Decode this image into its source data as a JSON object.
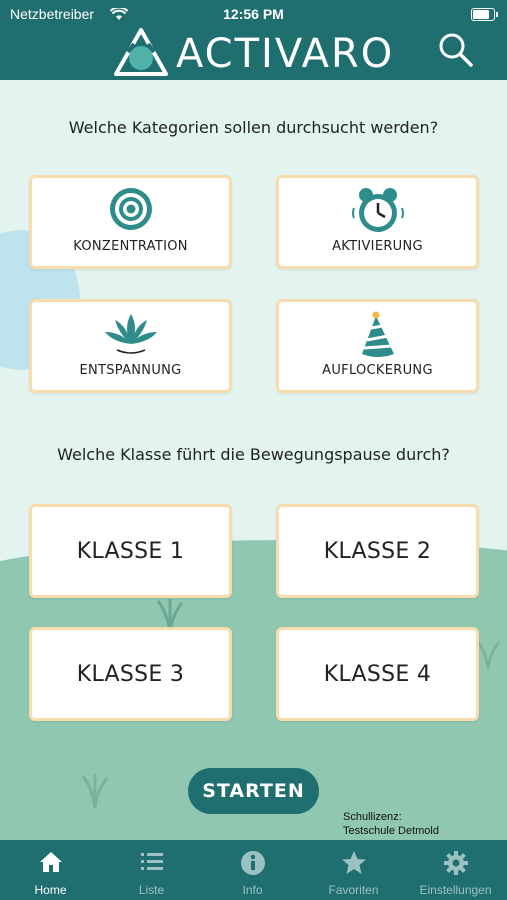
{
  "status": {
    "carrier": "Netzbetreiber",
    "time": "12:56 PM",
    "battery_level": 0.9
  },
  "app": {
    "title": "ACTIVARO",
    "search_icon": "search-icon"
  },
  "categories": {
    "question": "Welche Kategorien sollen durchsucht werden?",
    "items": [
      {
        "label": "KONZENTRATION",
        "icon": "target-icon"
      },
      {
        "label": "AKTIVIERUNG",
        "icon": "alarm-clock-icon"
      },
      {
        "label": "ENTSPANNUNG",
        "icon": "lotus-icon"
      },
      {
        "label": "AUFLOCKERUNG",
        "icon": "party-hat-icon"
      }
    ]
  },
  "classes": {
    "question": "Welche Klasse führt die Bewegungspause durch?",
    "items": [
      {
        "label": "KLASSE 1"
      },
      {
        "label": "KLASSE 2"
      },
      {
        "label": "KLASSE 3"
      },
      {
        "label": "KLASSE 4"
      }
    ]
  },
  "start_label": "STARTEN",
  "license": {
    "line1": "Schullizenz:",
    "line2": "Testschule Detmold"
  },
  "tabs": [
    {
      "label": "Home",
      "icon": "home-icon",
      "active": true
    },
    {
      "label": "Liste",
      "icon": "list-icon",
      "active": false
    },
    {
      "label": "Info",
      "icon": "info-icon",
      "active": false
    },
    {
      "label": "Favoriten",
      "icon": "star-icon",
      "active": false
    },
    {
      "label": "Einstellungen",
      "icon": "gear-icon",
      "active": false
    }
  ],
  "colors": {
    "primary": "#1f6e70",
    "tile_border": "#f7dcae",
    "background": "#e3f4ef",
    "hill": "#8fc7b0",
    "accent": "#2e8d8a"
  }
}
